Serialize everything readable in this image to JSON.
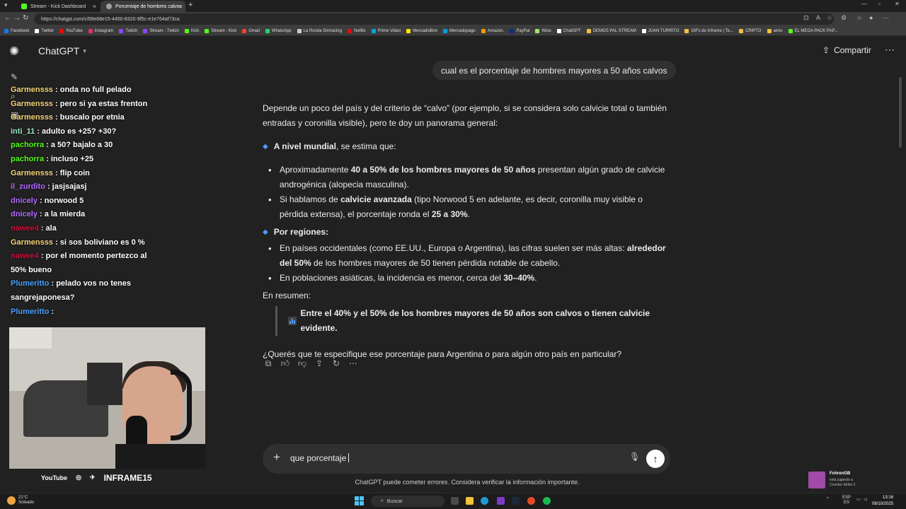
{
  "browser": {
    "tabs": [
      {
        "title": "Stream - Kick Dashboard",
        "color": "#53fc18"
      },
      {
        "title": "Porcentaje de hombres calvos",
        "color": "#a0a0a0"
      }
    ],
    "url": "https://chatgpt.com/c/68e68e15-4450-8320-9f5c-e1e764af73ca",
    "bookmarks": [
      {
        "label": "Facebook",
        "color": "#1877f2"
      },
      {
        "label": "Twitter",
        "color": "#ffffff"
      },
      {
        "label": "YouTube",
        "color": "#ff0000"
      },
      {
        "label": "Instagram",
        "color": "#e1306c"
      },
      {
        "label": "Twitch",
        "color": "#9146ff"
      },
      {
        "label": "Stream - Twitch",
        "color": "#9146ff"
      },
      {
        "label": "Kick",
        "color": "#53fc18"
      },
      {
        "label": "Stream - Kick",
        "color": "#53fc18"
      },
      {
        "label": "Gmail",
        "color": "#ea4335"
      },
      {
        "label": "WhatsApp",
        "color": "#25d366"
      },
      {
        "label": "La Ronda Simracing",
        "color": "#cccccc"
      },
      {
        "label": "Netflix",
        "color": "#e50914"
      },
      {
        "label": "Prime Video",
        "color": "#00a8e1"
      },
      {
        "label": "Mercadolibre",
        "color": "#ffe600"
      },
      {
        "label": "Mercadopago",
        "color": "#009ee3"
      },
      {
        "label": "Amazon.",
        "color": "#ff9900"
      },
      {
        "label": "PayPal",
        "color": "#003087"
      },
      {
        "label": "Wise",
        "color": "#9fe870"
      },
      {
        "label": "ChatGPT",
        "color": "#ffffff"
      },
      {
        "label": "DEMOS PAL STREAM",
        "color": "#f0c040"
      },
      {
        "label": "JUAN TURRITO",
        "color": "#ffffff"
      },
      {
        "label": "GIFs de Inframe | Te...",
        "color": "#f0c040"
      },
      {
        "label": "CRIPTO",
        "color": "#f0c040"
      },
      {
        "label": "aires",
        "color": "#f0c040"
      },
      {
        "label": "EL MEGA PACK PAP...",
        "color": "#53fc18"
      }
    ]
  },
  "app": {
    "model_name": "ChatGPT",
    "share_label": "Compartir",
    "user_message": "cual es el porcentaje de hombres mayores a 50 años calvos",
    "answer": {
      "intro": "Depende un poco del país y del criterio de “calvo” (por ejemplo, si se considera solo calvicie total o también entradas y coronilla visible), pero te doy un panorama general:",
      "global_heading_bold": "A nivel mundial",
      "global_heading_rest": ", se estima que:",
      "b1_pre": "Aproximadamente ",
      "b1_bold": "40 a 50% de los hombres mayores de 50 años",
      "b1_post": " presentan algún grado de calvicie androgénica (alopecia masculina).",
      "b2_pre": "Si hablamos de ",
      "b2_bold": "calvicie avanzada",
      "b2_mid": " (tipo Norwood 5 en adelante, es decir, coronilla muy visible o pérdida extensa), el porcentaje ronda el ",
      "b2_bold2": "25 a 30%",
      "b2_post": ".",
      "regions_heading": "Por regiones:",
      "r1_pre": "En países occidentales (como EE.UU., Europa o Argentina), las cifras suelen ser más altas: ",
      "r1_bold": "alrededor del 50%",
      "r1_post": " de los hombres mayores de 50 tienen pérdida notable de cabello.",
      "r2_pre": "En poblaciones asiáticas, la incidencia es menor, cerca del ",
      "r2_bold": "30–40%",
      "r2_post": ".",
      "summary_label": "En resumen:",
      "summary_quote": "Entre el 40% y el 50% de los hombres mayores de 50 años son calvos o tienen calvicie evidente.",
      "followup": "¿Querés que te especifique ese porcentaje para Argentina o para algún otro país en particular?"
    },
    "composer_value": "que porcentaje",
    "disclaimer": "ChatGPT puede cometer errores. Considera verificar la información importante."
  },
  "stream_chat": [
    {
      "user": "Garmensss",
      "color": "#f5d67a",
      "text": ": onda no full pelado"
    },
    {
      "user": "Garmensss",
      "color": "#f5d67a",
      "text": ": pero si ya estas frenton"
    },
    {
      "user": "Garmensss",
      "color": "#f5d67a",
      "text": ": buscalo por etnia"
    },
    {
      "user": "inti_11",
      "color": "#9be7c4",
      "text": ": adulto es +25? +30?"
    },
    {
      "user": "pachorra",
      "color": "#53fc18",
      "text": ": a 50? bajalo a 30"
    },
    {
      "user": "pachorra",
      "color": "#53fc18",
      "text": ": incluso +25"
    },
    {
      "user": "Garmensss",
      "color": "#f5d67a",
      "text": ": flip coin"
    },
    {
      "user": "il_zurdito",
      "color": "#b36bff",
      "text": ": jasjsajasj"
    },
    {
      "user": "dnicely",
      "color": "#b36bff",
      "text": ": norwood 5"
    },
    {
      "user": "dnicely",
      "color": "#b36bff",
      "text": ": a la mierda"
    },
    {
      "user": "nawee4",
      "color": "#d0103a",
      "text": ": ala"
    },
    {
      "user": "Garmensss",
      "color": "#f5d67a",
      "text": ": si sos boliviano es 0 %"
    },
    {
      "user": "nawee4",
      "color": "#d0103a",
      "text": ": por el momento pertezco al 50% bueno"
    },
    {
      "user": "Plumeritto",
      "color": "#4aa3ff",
      "text": ": pelado vos no tenes sangrejaponesa?"
    },
    {
      "user": "Plumeritto",
      "color": "#4aa3ff",
      "text": ":"
    }
  ],
  "webcam_footer": {
    "left": "YouTube",
    "right": "INFRAME15"
  },
  "notification": {
    "name": "FohrenGB",
    "line1": "está jugando a",
    "line2": "Counter-Strike 2"
  },
  "taskbar": {
    "temp": "21°C",
    "weather": "Soleado",
    "search_placeholder": "Buscar",
    "lang1": "ESP",
    "lang2": "ES",
    "time": "13:16",
    "date": "08/10/2025"
  }
}
